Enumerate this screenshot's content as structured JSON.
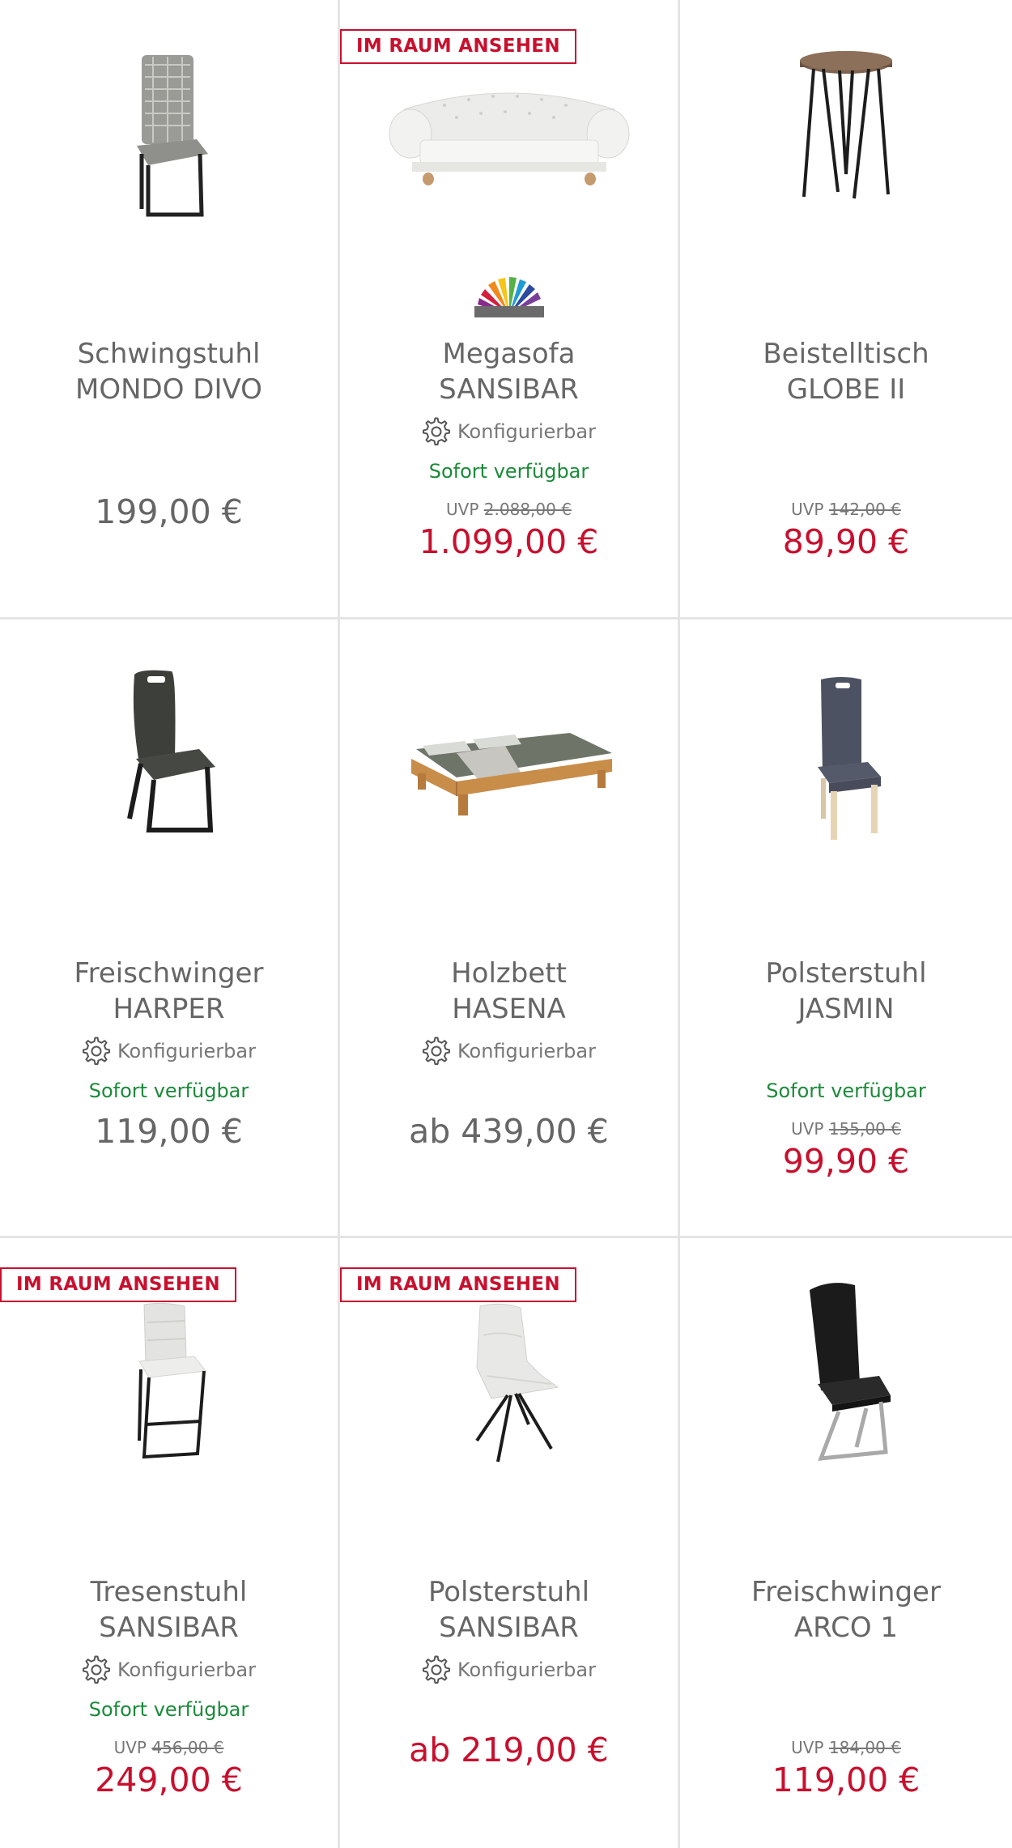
{
  "badge_label": "IM RAUM ANSEHEN",
  "konfig_label": "Konfigurierbar",
  "colors": {
    "accent_red": "#c8102e",
    "available_green": "#1b8a3a",
    "divider": "#e4e4e4",
    "text_gray": "#666666"
  },
  "products": [
    {
      "line1": "Schwingstuhl",
      "line2": "MONDO DIVO",
      "price": "199,00 €",
      "image_icon": "cantilever-chair-icon"
    },
    {
      "line1": "Megasofa",
      "line2": "SANSIBAR",
      "konfig": "Konfigurierbar",
      "availability": "Sofort verfügbar",
      "uvp_label": "UVP",
      "uvp": "2.088,00 €",
      "price": "1.099,00 €",
      "badge": "IM RAUM ANSEHEN",
      "image_icon": "chesterfield-sofa-icon",
      "brand_icon": "color-fan-logo-icon"
    },
    {
      "line1": "Beistelltisch",
      "line2": "GLOBE II",
      "uvp_label": "UVP",
      "uvp": "142,00 €",
      "price": "89,90 €",
      "image_icon": "side-table-icon"
    },
    {
      "line1": "Freischwinger",
      "line2": "HARPER",
      "konfig": "Konfigurierbar",
      "availability": "Sofort verfügbar",
      "price": "119,00 €",
      "image_icon": "cantilever-chair-dark-icon"
    },
    {
      "line1": "Holzbett",
      "line2": "HASENA",
      "konfig": "Konfigurierbar",
      "price": "ab 439,00 €",
      "image_icon": "wooden-bed-icon"
    },
    {
      "line1": "Polsterstuhl",
      "line2": "JASMIN",
      "availability": "Sofort verfügbar",
      "uvp_label": "UVP",
      "uvp": "155,00 €",
      "price": "99,90 €",
      "image_icon": "upholstered-chair-icon"
    },
    {
      "line1": "Tresenstuhl",
      "line2": "SANSIBAR",
      "konfig": "Konfigurierbar",
      "availability": "Sofort verfügbar",
      "uvp_label": "UVP",
      "uvp": "456,00 €",
      "price": "249,00 €",
      "badge": "IM RAUM ANSEHEN",
      "image_icon": "bar-stool-icon"
    },
    {
      "line1": "Polsterstuhl",
      "line2": "SANSIBAR",
      "konfig": "Konfigurierbar",
      "price": "ab 219,00 €",
      "badge": "IM RAUM ANSEHEN",
      "image_icon": "shell-chair-icon"
    },
    {
      "line1": "Freischwinger",
      "line2": "ARCO 1",
      "uvp_label": "UVP",
      "uvp": "184,00 €",
      "price": "119,00 €",
      "image_icon": "leather-cantilever-chair-icon"
    }
  ]
}
